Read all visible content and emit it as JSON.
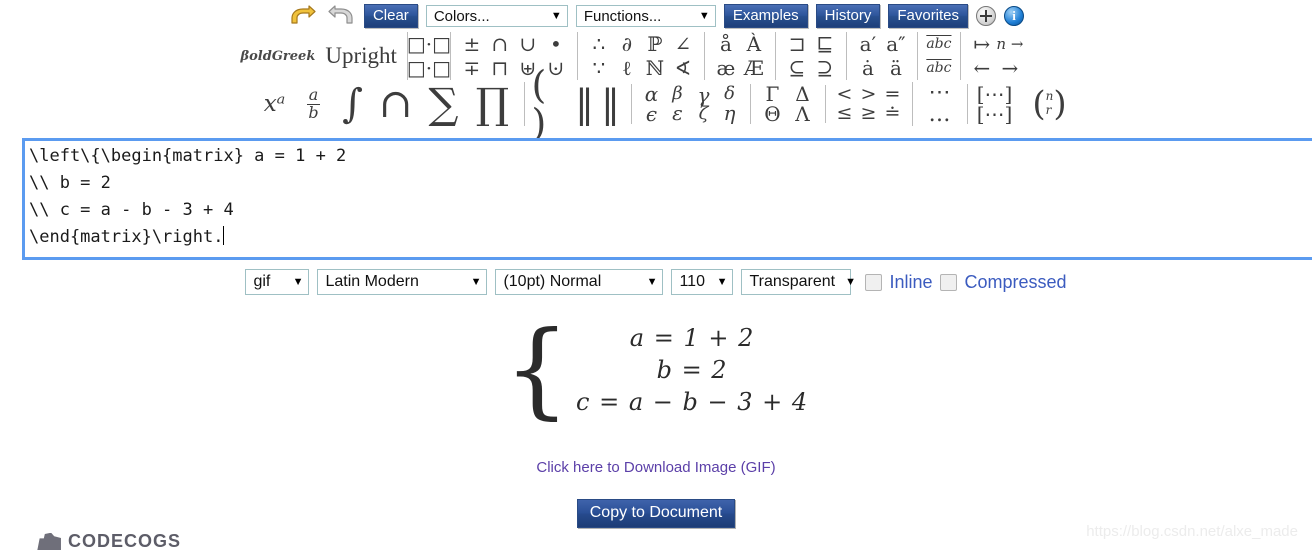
{
  "toolbar": {
    "undo_icon": "undo-icon",
    "redo_icon": "redo-icon",
    "clear_label": "Clear",
    "colors_label": "Colors...",
    "functions_label": "Functions...",
    "examples_label": "Examples",
    "history_label": "History",
    "favorites_label": "Favorites",
    "add_icon": "plus-circle-icon",
    "info_icon": "info-circle-icon",
    "caret": "▼"
  },
  "palette": {
    "boldgreek_label": "βoldGreek",
    "upright_label": "Upright",
    "groups": [
      {
        "name": "boxes",
        "top": [
          "□·□"
        ],
        "bottom": [
          "□·□"
        ]
      },
      {
        "name": "operators",
        "top": [
          "±",
          "∩",
          "∪",
          "•"
        ],
        "bottom": [
          "∓",
          "⊓",
          "⊎",
          "⊍"
        ]
      },
      {
        "name": "logic",
        "top": [
          "∴",
          "∂",
          "ℙ",
          "∠"
        ],
        "bottom": [
          "∵",
          "ℓ",
          "ℕ",
          "∢"
        ]
      },
      {
        "name": "accents",
        "top": [
          "å",
          "À"
        ],
        "bottom": [
          "æ",
          "Æ"
        ]
      },
      {
        "name": "subsets",
        "top": [
          "⊐",
          "⊑"
        ],
        "bottom": [
          "⊆",
          "⊇"
        ]
      },
      {
        "name": "primes",
        "top": [
          "a′",
          "a″"
        ],
        "bottom": [
          "ȧ",
          "ä"
        ]
      },
      {
        "name": "overline",
        "top": [
          "abc"
        ],
        "bottom": [
          "abc"
        ]
      },
      {
        "name": "arrows",
        "top": [
          "↦",
          "n →"
        ],
        "bottom": [
          "←",
          "→"
        ]
      }
    ],
    "big_groups": [
      {
        "name": "structures",
        "items": [
          "xᵃ",
          "a/b",
          "∫",
          "∩",
          "∑",
          "∏"
        ]
      },
      {
        "name": "delimiters",
        "items": [
          "( )",
          "‖",
          "‖"
        ]
      },
      {
        "name": "greek-lower",
        "top": [
          "α",
          "β",
          "γ",
          "δ"
        ],
        "bottom": [
          "ϵ",
          "ε",
          "ζ",
          "η"
        ]
      },
      {
        "name": "greek-upper",
        "top": [
          "Γ",
          "Δ"
        ],
        "bottom": [
          "Θ",
          "Λ"
        ]
      },
      {
        "name": "relations",
        "top": [
          "<",
          ">",
          "="
        ],
        "bottom": [
          "≤",
          "≥",
          "≐"
        ]
      },
      {
        "name": "dots",
        "top": [
          "⋯"
        ],
        "bottom": [
          "…"
        ]
      },
      {
        "name": "matrix",
        "items": [
          "[⋯]"
        ]
      },
      {
        "name": "binomial",
        "items": [
          "(n r)"
        ]
      }
    ]
  },
  "editor": {
    "lines": [
      "\\left\\{\\begin{matrix} a = 1 + 2",
      "\\\\ b = 2",
      "\\\\ c = a - b - 3 + 4",
      "\\end{matrix}\\right."
    ]
  },
  "options": {
    "format": "gif",
    "font": "Latin Modern",
    "size": "(10pt) Normal",
    "dpi": "110",
    "background": "Transparent",
    "inline_label": "Inline",
    "inline_checked": false,
    "compressed_label": "Compressed",
    "compressed_checked": false,
    "caret": "▼"
  },
  "render": {
    "brace": "{",
    "equations": [
      "a = 1 + 2",
      "b = 2",
      "c = a − b − 3 + 4"
    ]
  },
  "footer": {
    "download_label": "Click here to Download Image (GIF)",
    "copy_label": "Copy to Document",
    "logo_word": "CODECOGS",
    "watermark": "https://blog.csdn.net/alxe_made"
  },
  "colors": {
    "button_blue": "#2d559b",
    "link_purple": "#5b3fa8",
    "focus_border": "#5b9bf0",
    "checkbox_label": "#3b5bbf"
  }
}
